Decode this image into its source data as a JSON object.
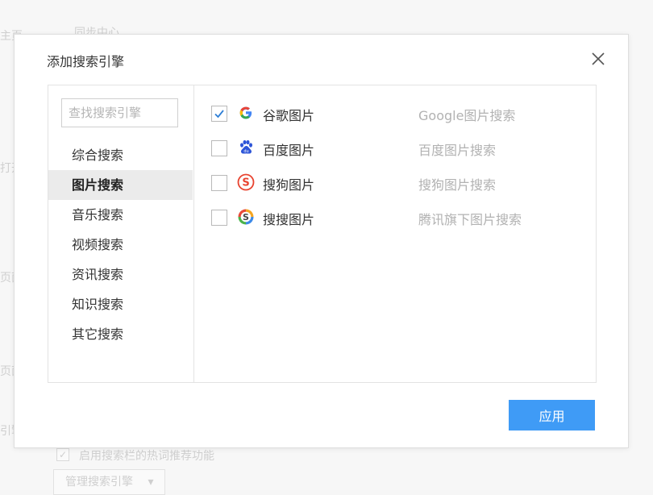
{
  "background": {
    "fragments": [
      "主页",
      "同步中心",
      "打开",
      "页面",
      "页面",
      "引擎",
      "启用搜索栏的热词推荐功能"
    ],
    "manage_button": "管理搜索引擎",
    "manage_button_arrow": "▾"
  },
  "dialog": {
    "title": "添加搜索引擎",
    "close_icon": "close-icon",
    "search": {
      "placeholder": "查找搜索引擎",
      "value": ""
    },
    "categories": [
      {
        "label": "综合搜索",
        "active": false
      },
      {
        "label": "图片搜索",
        "active": true
      },
      {
        "label": "音乐搜索",
        "active": false
      },
      {
        "label": "视频搜索",
        "active": false
      },
      {
        "label": "资讯搜索",
        "active": false
      },
      {
        "label": "知识搜索",
        "active": false
      },
      {
        "label": "其它搜索",
        "active": false
      }
    ],
    "engines": [
      {
        "name": "谷歌图片",
        "description": "Google图片搜索",
        "checked": true,
        "icon": "google-icon"
      },
      {
        "name": "百度图片",
        "description": "百度图片搜索",
        "checked": false,
        "icon": "baidu-paw-icon"
      },
      {
        "name": "搜狗图片",
        "description": "搜狗图片搜索",
        "checked": false,
        "icon": "sogou-icon"
      },
      {
        "name": "搜搜图片",
        "description": "腾讯旗下图片搜索",
        "checked": false,
        "icon": "soso-icon"
      }
    ],
    "apply_button": "应用"
  },
  "colors": {
    "accent": "#3f9bf6",
    "check_mark": "#2f7fd6",
    "active_category_bg": "#ebebeb"
  }
}
